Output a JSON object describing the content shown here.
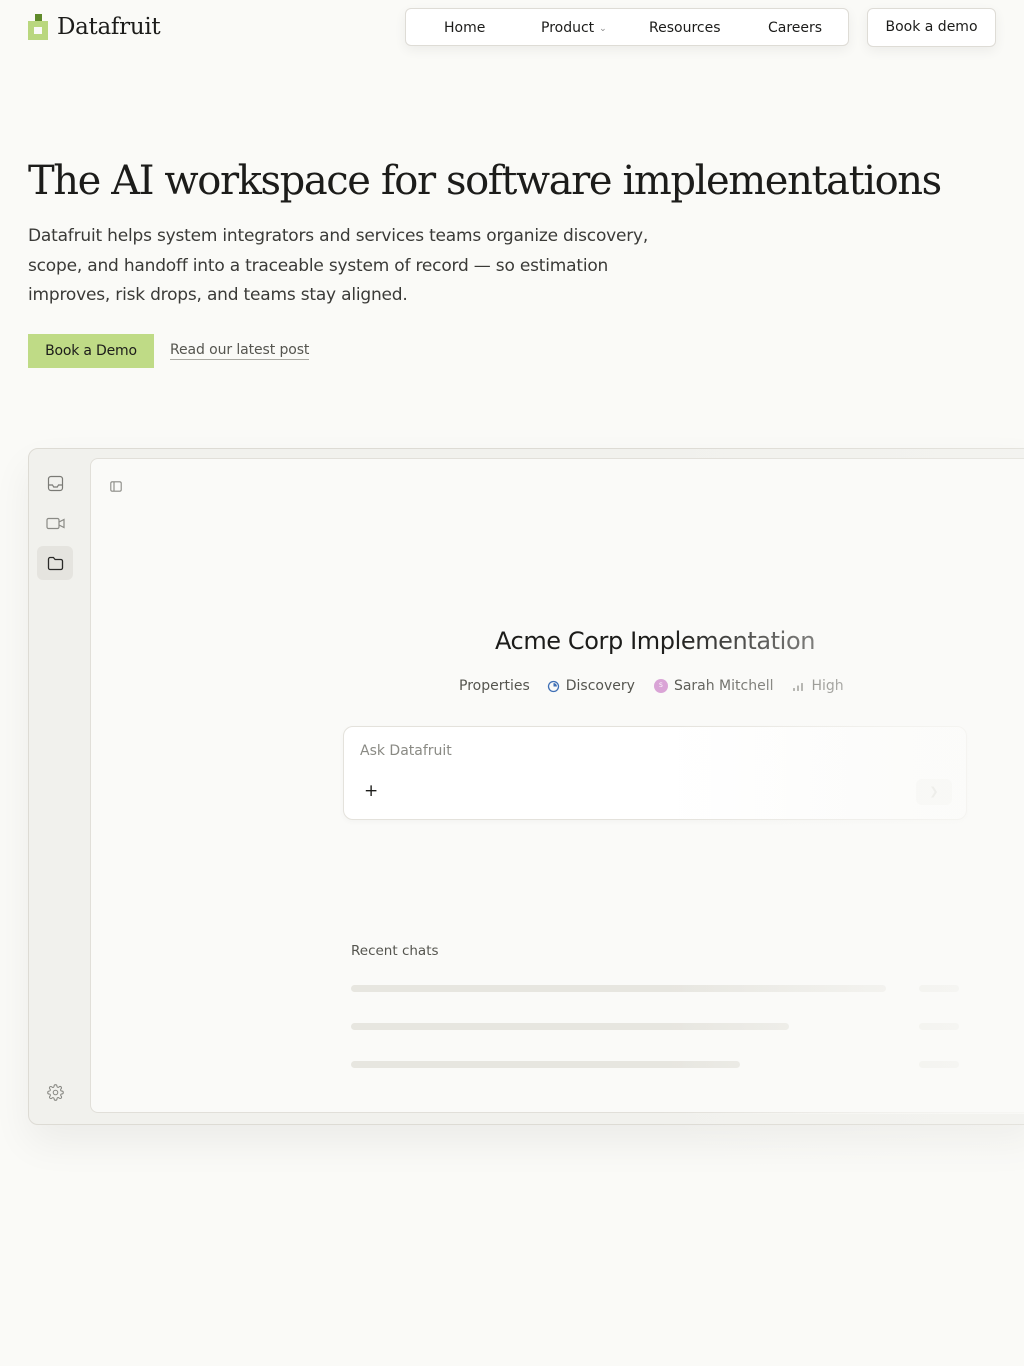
{
  "brand": {
    "name": "Datafruit"
  },
  "nav": {
    "items": [
      {
        "label": "Home"
      },
      {
        "label": "Product",
        "has_dropdown": true
      },
      {
        "label": "Resources"
      },
      {
        "label": "Careers"
      }
    ],
    "cta_label": "Book a demo"
  },
  "hero": {
    "title": "The AI workspace for software implementations",
    "subtitle": "Datafruit helps system integrators and services teams organize discovery, scope, and handoff into a traceable system of record — so estimation improves, risk drops, and teams stay aligned.",
    "primary_cta": "Book a Demo",
    "secondary_link": "Read our latest post"
  },
  "app": {
    "rail": [
      {
        "icon": "inbox-icon"
      },
      {
        "icon": "video-icon"
      },
      {
        "icon": "folder-icon",
        "active": true
      },
      {
        "icon": "gear-icon"
      }
    ],
    "project": {
      "title": "Acme Corp Implementation",
      "properties_label": "Properties",
      "status": "Discovery",
      "owner": "Sarah Mitchell",
      "owner_initial": "S",
      "priority": "High"
    },
    "ask": {
      "placeholder": "Ask Datafruit",
      "value": ""
    },
    "recent_chats_label": "Recent chats"
  },
  "colors": {
    "page_bg": "#fafaf7",
    "accent": "#bfdb86",
    "logo_dark": "#5f8a2a",
    "avatar": "#d9a3d6"
  }
}
